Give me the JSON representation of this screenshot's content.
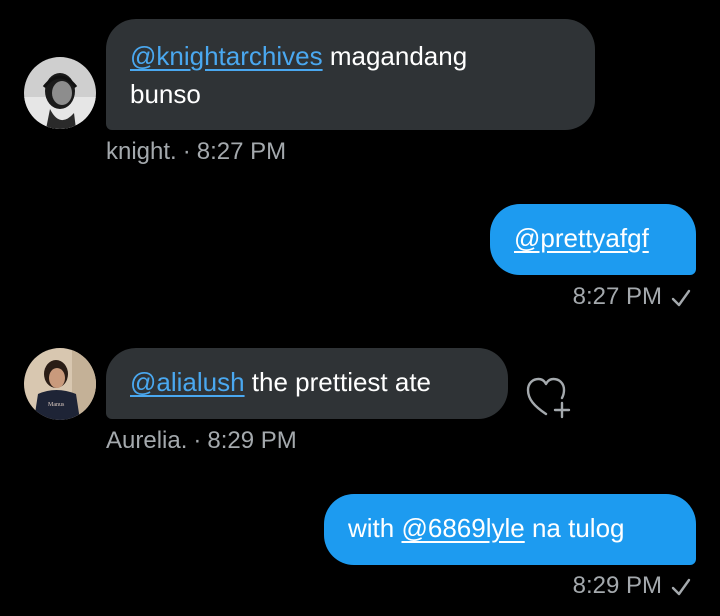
{
  "messages": [
    {
      "sender": "knight.",
      "mention": "@knightarchives",
      "text_line1": "magandang",
      "text_line2": "bunso",
      "time": "8:27 PM"
    },
    {
      "mention": "@prettyafgf",
      "time": "8:27 PM"
    },
    {
      "sender": "Aurelia.",
      "mention": "@alialush",
      "text": "the prettiest ate",
      "time": "8:29 PM"
    },
    {
      "prefix": "with",
      "mention": "@6869lyle",
      "suffix": "na tulog",
      "time": "8:29 PM"
    }
  ],
  "separator": "·",
  "icons": {
    "read_receipt": "check-icon",
    "reaction": "heart-plus-icon"
  },
  "colors": {
    "background": "#000000",
    "incoming_bubble": "#2f3336",
    "outgoing_bubble": "#1d9bf0",
    "mention_incoming": "#4aa8f0",
    "meta_text": "#a4a9ad"
  }
}
